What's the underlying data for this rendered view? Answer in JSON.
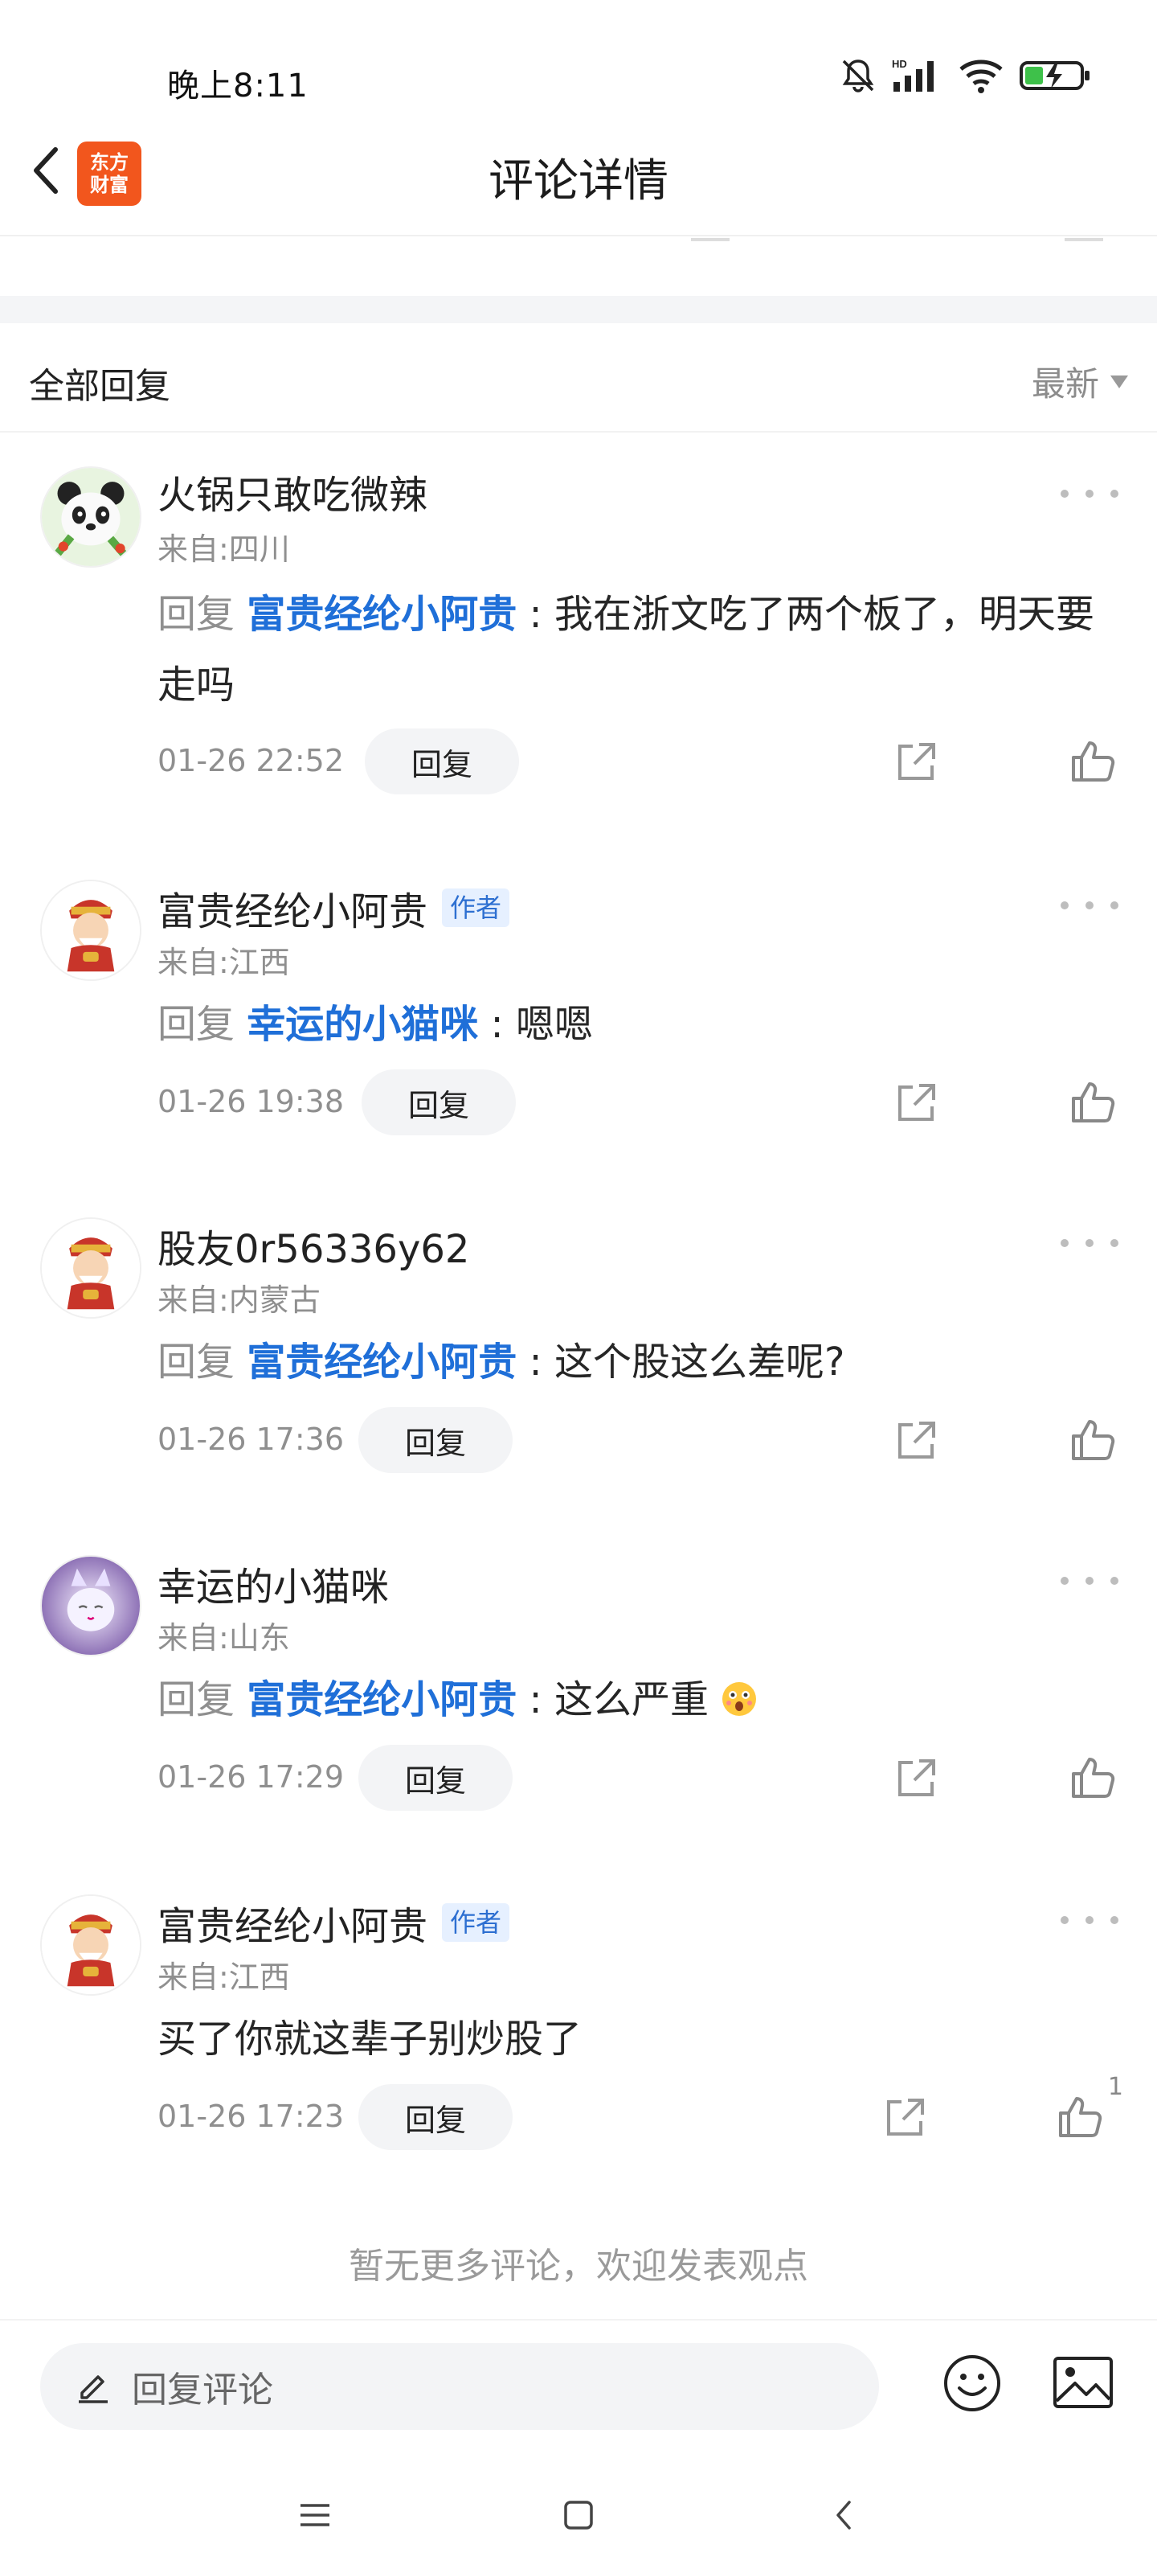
{
  "status_bar": {
    "time": "晚上8:11",
    "icons": [
      "bell-muted-icon",
      "hd-signal-icon",
      "wifi-icon",
      "battery-charging-icon"
    ]
  },
  "header": {
    "title": "评论详情",
    "logo_text_line1": "东方",
    "logo_text_line2": "财富",
    "back_icon": "chevron-left-icon"
  },
  "section": {
    "title": "全部回复",
    "sort_label": "最新"
  },
  "labels": {
    "reply_prefix": "回复",
    "reply_button": "回复",
    "author_badge": "作者"
  },
  "comments": [
    {
      "username": "火锅只敢吃微辣",
      "origin": "来自:四川",
      "is_author": false,
      "reply_to": "富贵经纶小阿贵",
      "text": "我在浙文吃了两个板了，明天要走吗",
      "time": "01-26 22:52",
      "likes": ""
    },
    {
      "username": "富贵经纶小阿贵",
      "origin": "来自:江西",
      "is_author": true,
      "reply_to": "幸运的小猫咪",
      "text": "嗯嗯",
      "time": "01-26 19:38",
      "likes": ""
    },
    {
      "username": "股友0r56336y62",
      "origin": "来自:内蒙古",
      "is_author": false,
      "reply_to": "富贵经纶小阿贵",
      "text": "这个股这么差呢?",
      "time": "01-26 17:36",
      "likes": ""
    },
    {
      "username": "幸运的小猫咪",
      "origin": "来自:山东",
      "is_author": false,
      "reply_to": "富贵经纶小阿贵",
      "text": "这么严重",
      "time": "01-26 17:29",
      "likes": ""
    },
    {
      "username": "富贵经纶小阿贵",
      "origin": "来自:江西",
      "is_author": true,
      "reply_to": "",
      "text": "买了你就这辈子别炒股了",
      "time": "01-26 17:23",
      "likes": "1"
    }
  ],
  "end_tip": "暂无更多评论，欢迎发表观点",
  "input_bar": {
    "placeholder": "回复评论"
  },
  "colors": {
    "mention": "#1f6fd8",
    "logo_bg": "#f2561d",
    "battery_accent": "#3ec14a"
  }
}
